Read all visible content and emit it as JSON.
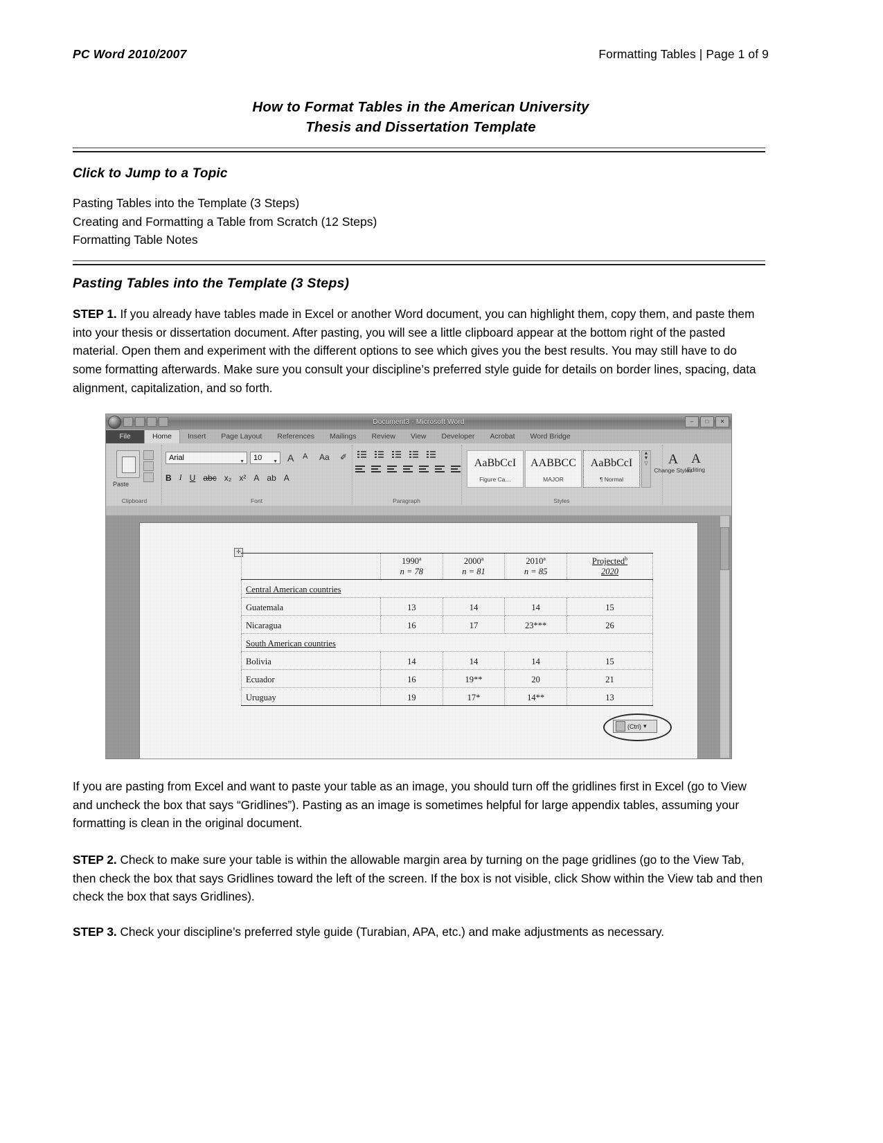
{
  "header": {
    "left": "PC Word 2010/2007",
    "right": "Formatting Tables | Page 1 of 9"
  },
  "title": {
    "line1": "How to Format Tables in the American University",
    "line2": "Thesis and Dissertation Template"
  },
  "jump": {
    "heading": "Click to Jump to a Topic",
    "links": [
      "Pasting Tables into the Template (3 Steps)",
      "Creating and Formatting a Table from Scratch (12 Steps)",
      "Formatting Table Notes"
    ]
  },
  "section": {
    "heading": "Pasting Tables into the Template (3 Steps)"
  },
  "paragraphs": {
    "step1_label": "STEP 1.",
    "step1_text": " If you already have tables made in Excel or another Word document, you can highlight them, copy them, and paste them into your thesis or dissertation document. After pasting, you will see a little clipboard appear at the bottom right of the pasted material. Open them and experiment with the different options to see which gives you the best results. You may still have to do some formatting afterwards. Make sure you consult your discipline’s preferred style guide for details on border lines, spacing, data alignment, capitalization, and so forth.",
    "excel_note": "If you are pasting from Excel and want to paste your table as an image, you should turn off the gridlines first in Excel (go to View and uncheck the box that says “Gridlines”). Pasting as an image is sometimes helpful for large appendix tables, assuming your formatting is clean in the original document.",
    "step2_label": "STEP 2.",
    "step2_text": " Check to make sure your table is within the allowable margin area by turning on the page gridlines (go to the View Tab, then check the box that says Gridlines toward the left of the screen. If the box is not visible, click Show within the View tab and then check the box that says Gridlines).",
    "step3_label": "STEP 3.",
    "step3_text": " Check your discipline’s preferred style guide (Turabian, APA, etc.) and make adjustments as necessary."
  },
  "word": {
    "titlebar": "Document3 - Microsoft Word",
    "window_buttons": [
      "–",
      "□",
      "✕"
    ],
    "file_tab": "File",
    "tabs": [
      "Home",
      "Insert",
      "Page Layout",
      "References",
      "Mailings",
      "Review",
      "View",
      "Developer",
      "Acrobat",
      "Word Bridge"
    ],
    "groups": {
      "clipboard": "Clipboard",
      "font": "Font",
      "paragraph": "Paragraph",
      "styles": "Styles"
    },
    "clipboard": {
      "paste_label": "Paste"
    },
    "font": {
      "name": "Arial",
      "size": "10",
      "grow": "A",
      "shrink": "A",
      "change_case": "Aa",
      "clear_formatting": "✐",
      "bold": "B",
      "italic": "I",
      "underline": "U",
      "strikethrough": "abc",
      "subscript": "x₂",
      "superscript": "x²",
      "text_effects": "A",
      "highlight": "ab",
      "font_color": "A"
    },
    "styles": [
      {
        "sample": "AaBbCcI",
        "name": "Figure Ca…",
        "selected": false
      },
      {
        "sample": "AABBCC",
        "name": "MAJOR",
        "selected": false
      },
      {
        "sample": "AaBbCcI",
        "name": "¶ Normal",
        "selected": true
      }
    ],
    "change_styles": {
      "glyph": "A",
      "label": "Change Styles"
    },
    "editing": {
      "glyph": "A",
      "label": "Editing"
    },
    "paste_options": {
      "label": "(Ctrl)",
      "caret": "▾",
      "icon": "clipboard-icon"
    },
    "table": {
      "columns": [
        "",
        "1990",
        "2000",
        "2010",
        "Projected"
      ],
      "column_superscripts": [
        "",
        "a",
        "a",
        "a",
        "b"
      ],
      "subheaders": [
        "",
        "n = 78",
        "n = 81",
        "n = 85",
        "2020"
      ],
      "rows": [
        {
          "type": "group",
          "label": "Central American countries",
          "values": [
            "",
            "",
            "",
            ""
          ]
        },
        {
          "type": "data",
          "label": "Guatemala",
          "values": [
            "13",
            "14",
            "14",
            "15"
          ]
        },
        {
          "type": "data",
          "label": "Nicaragua",
          "values": [
            "16",
            "17",
            "23***",
            "26"
          ]
        },
        {
          "type": "group",
          "label": "South American countries",
          "values": [
            "",
            "",
            "",
            ""
          ]
        },
        {
          "type": "data",
          "label": "Bolivia",
          "values": [
            "14",
            "14",
            "14",
            "15"
          ]
        },
        {
          "type": "data",
          "label": "Ecuador",
          "values": [
            "16",
            "19**",
            "20",
            "21"
          ]
        },
        {
          "type": "data",
          "label": "Uruguay",
          "values": [
            "19",
            "17*",
            "14**",
            "13"
          ]
        }
      ]
    }
  }
}
